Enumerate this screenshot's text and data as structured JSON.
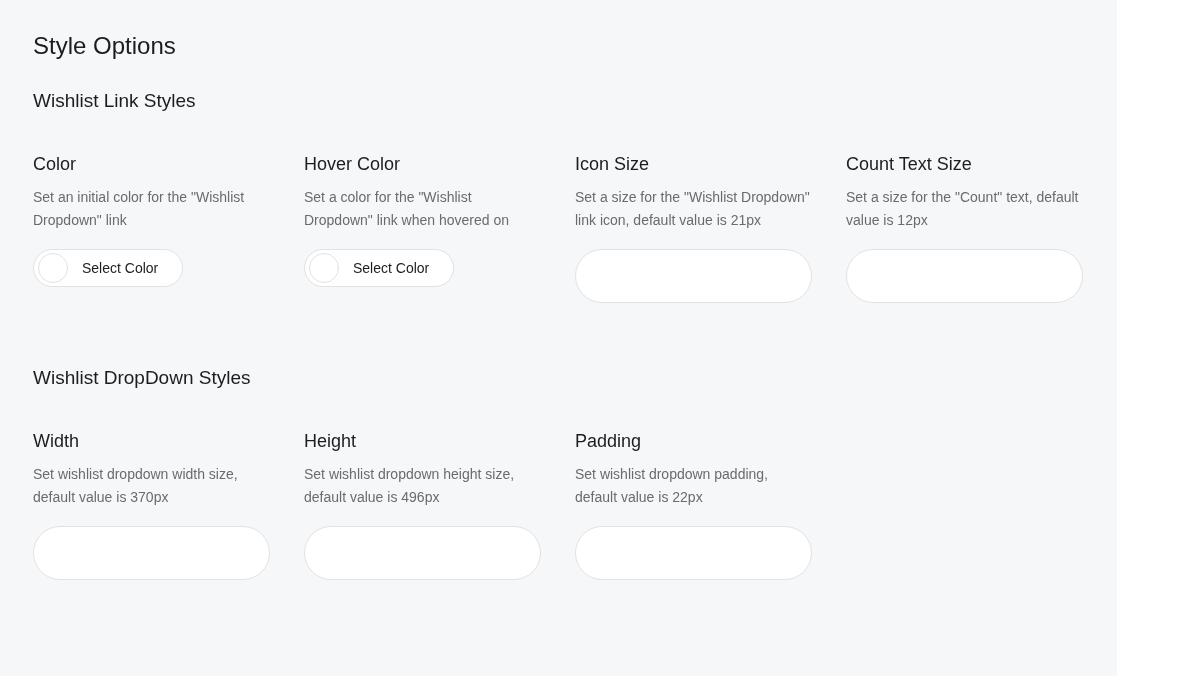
{
  "title": "Style Options",
  "sections": [
    {
      "title": "Wishlist Link Styles",
      "fields": [
        {
          "kind": "color",
          "label": "Color",
          "description": "Set an initial color for the \"Wishlist Dropdown\" link",
          "button_label": "Select Color"
        },
        {
          "kind": "color",
          "label": "Hover Color",
          "description": "Set a color for the \"Wishlist Dropdown\" link when hovered on",
          "button_label": "Select Color"
        },
        {
          "kind": "number",
          "label": "Icon Size",
          "description": "Set a size for the \"Wishlist Dropdown\" link icon, default value is 21px"
        },
        {
          "kind": "number",
          "label": "Count Text Size",
          "description": "Set a size for the \"Count\" text, default value is 12px"
        }
      ]
    },
    {
      "title": "Wishlist DropDown Styles",
      "fields": [
        {
          "kind": "number",
          "label": "Width",
          "description": "Set wishlist dropdown width size, default value is 370px"
        },
        {
          "kind": "number",
          "label": "Height",
          "description": "Set wishlist dropdown height size, default value is 496px"
        },
        {
          "kind": "number",
          "label": "Padding",
          "description": "Set wishlist dropdown padding, default value is 22px"
        }
      ]
    }
  ]
}
